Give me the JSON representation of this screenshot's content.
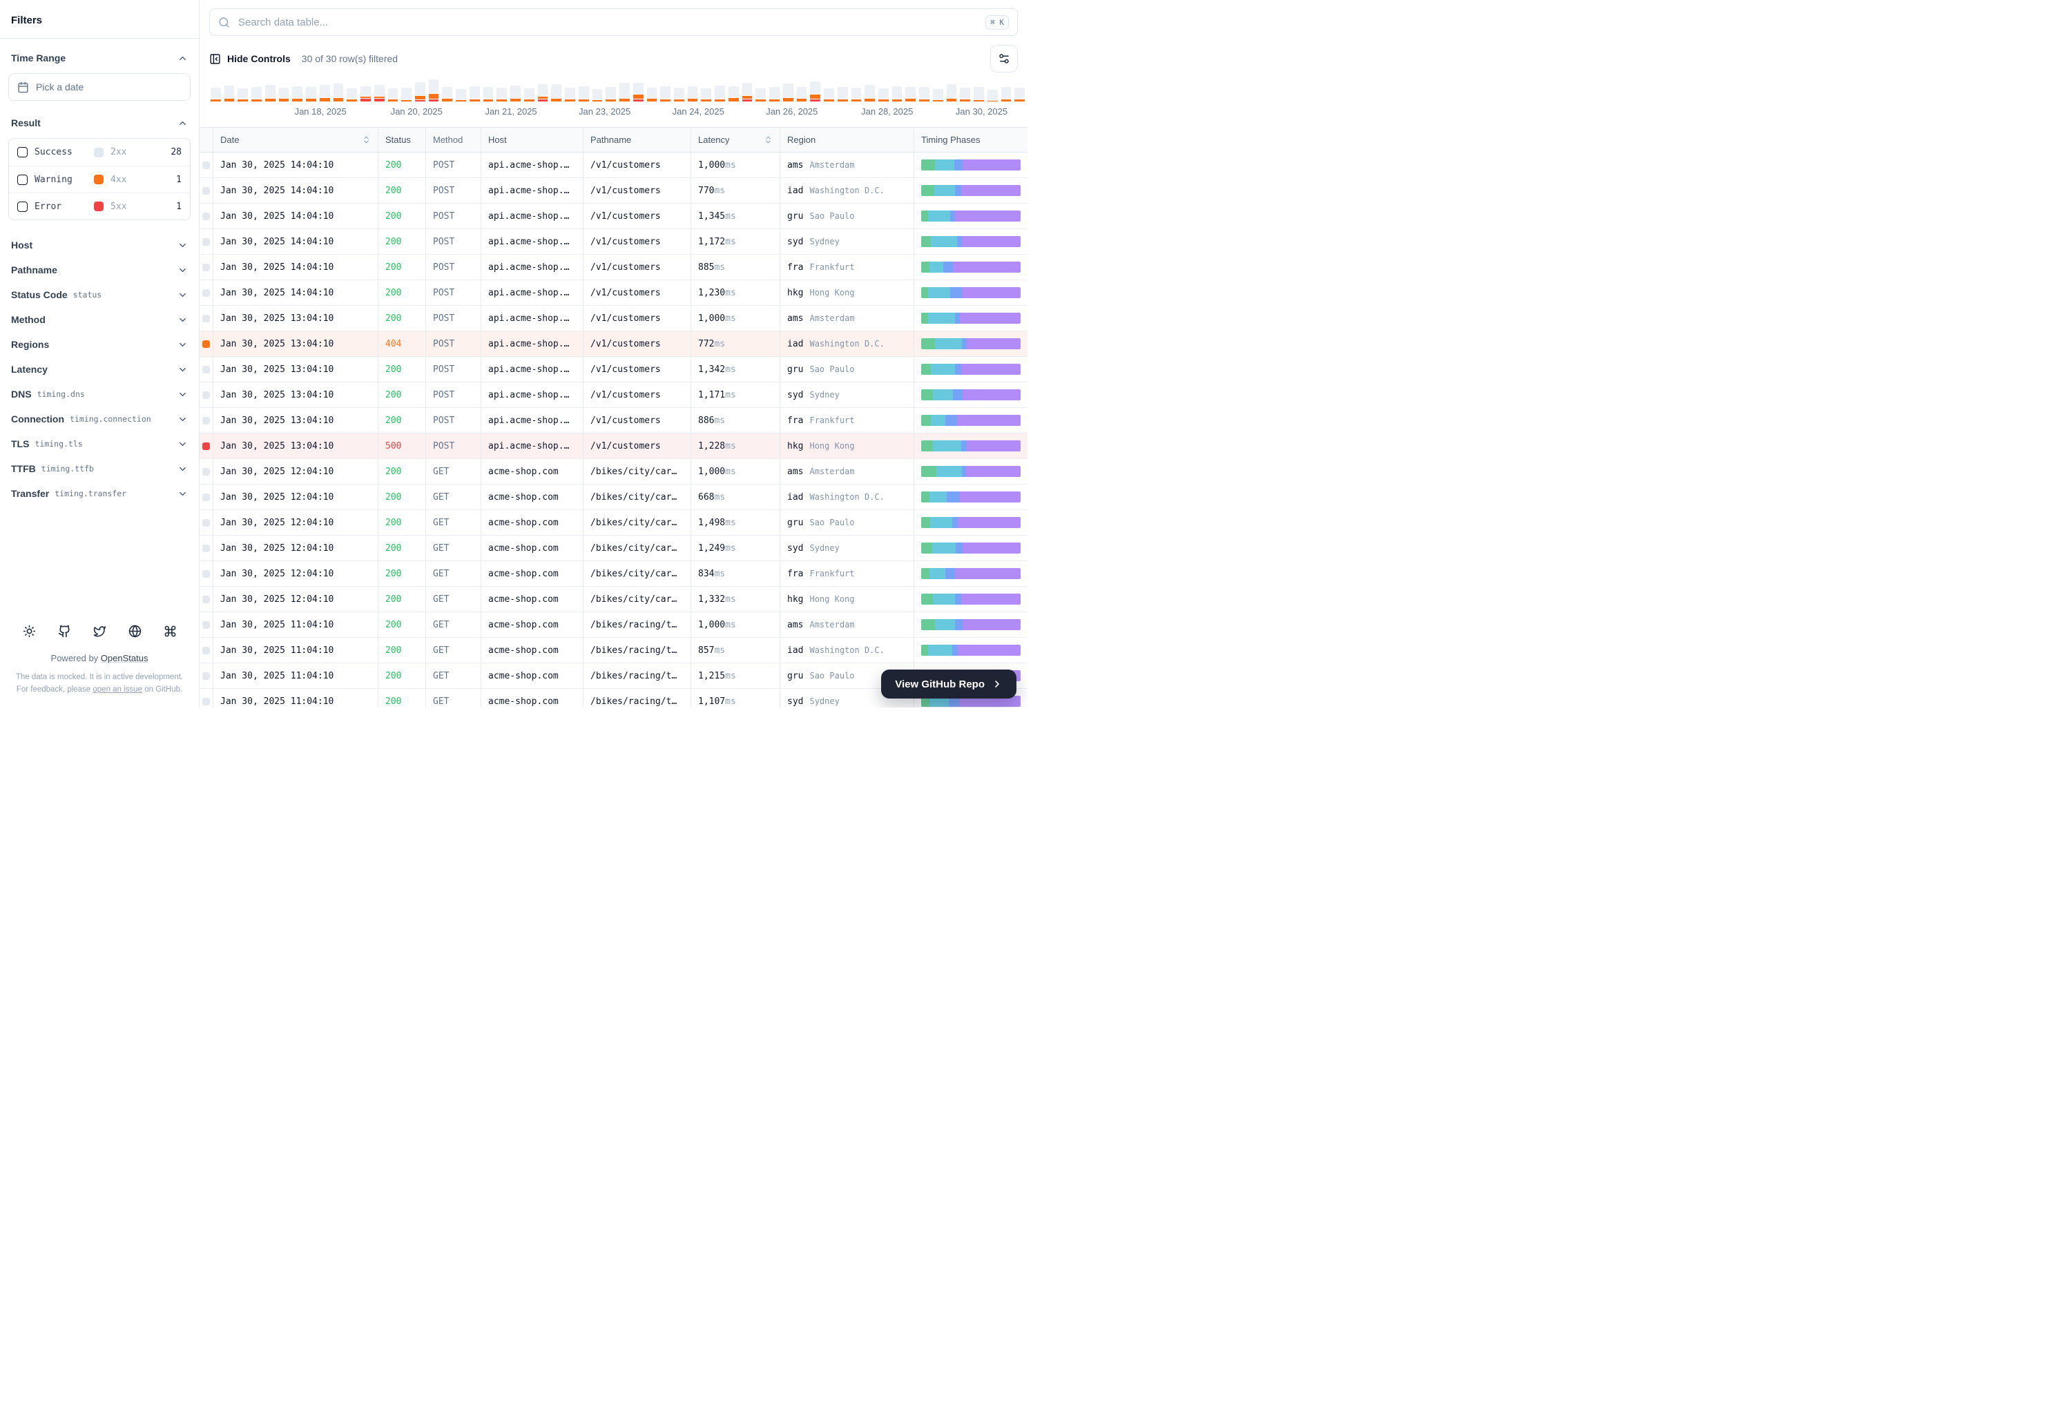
{
  "sidebar": {
    "title": "Filters",
    "time_range": {
      "label": "Time Range",
      "picker_placeholder": "Pick a date"
    },
    "result": {
      "label": "Result",
      "options": [
        {
          "label": "Success",
          "code": "2xx",
          "count": "28",
          "color": "#e2e8f0"
        },
        {
          "label": "Warning",
          "code": "4xx",
          "count": "1",
          "color": "#f97316"
        },
        {
          "label": "Error",
          "code": "5xx",
          "count": "1",
          "color": "#ef4444"
        }
      ]
    },
    "sections": [
      {
        "label": "Host",
        "sub": ""
      },
      {
        "label": "Pathname",
        "sub": ""
      },
      {
        "label": "Status Code",
        "sub": "status"
      },
      {
        "label": "Method",
        "sub": ""
      },
      {
        "label": "Regions",
        "sub": ""
      },
      {
        "label": "Latency",
        "sub": ""
      },
      {
        "label": "DNS",
        "sub": "timing.dns"
      },
      {
        "label": "Connection",
        "sub": "timing.connection"
      },
      {
        "label": "TLS",
        "sub": "timing.tls"
      },
      {
        "label": "TTFB",
        "sub": "timing.ttfb"
      },
      {
        "label": "Transfer",
        "sub": "timing.transfer"
      }
    ],
    "footer": {
      "icons": [
        "sun",
        "github",
        "twitter",
        "globe",
        "command"
      ],
      "powered_prefix": "Powered by ",
      "powered_link": "OpenStatus",
      "disclaimer_pre": "The data is mocked. It is in active development. For feedback, please ",
      "disclaimer_link": "open an issue",
      "disclaimer_post": " on GitHub."
    }
  },
  "toolbar": {
    "search_placeholder": "Search data table...",
    "kbd": "⌘ K",
    "hide_controls": "Hide Controls",
    "filtered": "30 of 30 row(s) filtered"
  },
  "chart_data": {
    "type": "bar",
    "stacked": true,
    "legend": "none",
    "x_tick_labels": [
      {
        "text": "Jan 18, 2025",
        "pos": 13.5
      },
      {
        "text": "Jan 20, 2025",
        "pos": 25.3
      },
      {
        "text": "Jan 21, 2025",
        "pos": 36.9
      },
      {
        "text": "Jan 23, 2025",
        "pos": 48.4
      },
      {
        "text": "Jan 24, 2025",
        "pos": 59.9
      },
      {
        "text": "Jan 26, 2025",
        "pos": 71.4
      },
      {
        "text": "Jan 28, 2025",
        "pos": 83.1
      },
      {
        "text": "Jan 30, 2025",
        "pos": 94.7
      }
    ],
    "series": [
      {
        "name": "success",
        "color": "#edf0f4",
        "values": [
          16,
          18,
          15,
          17,
          19,
          15,
          17,
          16,
          18,
          20,
          15,
          14,
          16,
          15,
          17,
          19,
          20,
          16,
          15,
          18,
          17,
          16,
          18,
          15,
          17,
          20,
          16,
          18,
          15,
          17,
          22,
          16,
          15,
          18,
          16,
          17,
          15,
          19,
          16,
          18,
          15,
          17,
          20,
          16,
          18,
          15,
          17,
          16,
          19,
          15,
          18,
          16,
          17,
          15,
          20,
          16,
          18,
          15,
          17,
          16
        ]
      },
      {
        "name": "warning",
        "color": "#f97316",
        "values": [
          3,
          4,
          3,
          3,
          4,
          4,
          4,
          4,
          5,
          5,
          3,
          2,
          2,
          3,
          2,
          5,
          7,
          4,
          2,
          3,
          3,
          3,
          4,
          3,
          3,
          4,
          3,
          3,
          2,
          3,
          4,
          6,
          4,
          3,
          3,
          4,
          3,
          3,
          5,
          4,
          3,
          3,
          5,
          4,
          6,
          3,
          3,
          3,
          4,
          3,
          3,
          4,
          3,
          2,
          4,
          3,
          2,
          1,
          3,
          3
        ]
      },
      {
        "name": "error",
        "color": "#ef4444",
        "values": [
          0,
          0,
          0,
          0,
          0,
          0,
          0,
          0,
          0,
          0,
          0,
          4,
          4,
          0,
          0,
          2,
          3,
          0,
          0,
          0,
          0,
          0,
          0,
          0,
          3,
          0,
          0,
          0,
          0,
          0,
          0,
          3,
          0,
          0,
          0,
          0,
          0,
          0,
          0,
          3,
          0,
          0,
          0,
          0,
          3,
          0,
          0,
          0,
          0,
          0,
          0,
          0,
          0,
          0,
          0,
          0,
          0,
          0,
          0,
          0
        ]
      }
    ]
  },
  "table": {
    "columns": [
      {
        "key": "indicator",
        "label": "",
        "sortable": false
      },
      {
        "key": "date",
        "label": "Date",
        "sortable": true
      },
      {
        "key": "status",
        "label": "Status",
        "sortable": false
      },
      {
        "key": "method",
        "label": "Method",
        "sortable": false
      },
      {
        "key": "host",
        "label": "Host",
        "sortable": false
      },
      {
        "key": "pathname",
        "label": "Pathname",
        "sortable": false
      },
      {
        "key": "latency",
        "label": "Latency",
        "sortable": true
      },
      {
        "key": "region",
        "label": "Region",
        "sortable": false
      },
      {
        "key": "timing",
        "label": "Timing Phases",
        "sortable": false
      }
    ],
    "latency_unit": "ms",
    "timing_colors": {
      "dns": "#68cb97",
      "connection": "#67c8de",
      "tls": "#76a3f7",
      "ttfb": "#b18cf8"
    },
    "rows": [
      {
        "date": "Jan 30, 2025 14:04:10",
        "status": "200",
        "level": "success",
        "method": "POST",
        "host": "api.acme-shop.…",
        "pathname": "/v1/customers",
        "latency": "1,000",
        "region_code": "ams",
        "region_city": "Amsterdam",
        "timing": [
          14,
          19,
          9,
          58
        ]
      },
      {
        "date": "Jan 30, 2025 14:04:10",
        "status": "200",
        "level": "success",
        "method": "POST",
        "host": "api.acme-shop.…",
        "pathname": "/v1/customers",
        "latency": "770",
        "region_code": "iad",
        "region_city": "Washington D.C.",
        "timing": [
          13,
          21,
          6,
          60
        ]
      },
      {
        "date": "Jan 30, 2025 14:04:10",
        "status": "200",
        "level": "success",
        "method": "POST",
        "host": "api.acme-shop.…",
        "pathname": "/v1/customers",
        "latency": "1,345",
        "region_code": "gru",
        "region_city": "Sao Paulo",
        "timing": [
          7,
          22,
          5,
          66
        ]
      },
      {
        "date": "Jan 30, 2025 14:04:10",
        "status": "200",
        "level": "success",
        "method": "POST",
        "host": "api.acme-shop.…",
        "pathname": "/v1/customers",
        "latency": "1,172",
        "region_code": "syd",
        "region_city": "Sydney",
        "timing": [
          10,
          26,
          5,
          59
        ]
      },
      {
        "date": "Jan 30, 2025 14:04:10",
        "status": "200",
        "level": "success",
        "method": "POST",
        "host": "api.acme-shop.…",
        "pathname": "/v1/customers",
        "latency": "885",
        "region_code": "fra",
        "region_city": "Frankfurt",
        "timing": [
          8,
          14,
          10,
          68
        ]
      },
      {
        "date": "Jan 30, 2025 14:04:10",
        "status": "200",
        "level": "success",
        "method": "POST",
        "host": "api.acme-shop.…",
        "pathname": "/v1/customers",
        "latency": "1,230",
        "region_code": "hkg",
        "region_city": "Hong Kong",
        "timing": [
          7,
          22,
          12,
          59
        ]
      },
      {
        "date": "Jan 30, 2025 13:04:10",
        "status": "200",
        "level": "success",
        "method": "POST",
        "host": "api.acme-shop.…",
        "pathname": "/v1/customers",
        "latency": "1,000",
        "region_code": "ams",
        "region_city": "Amsterdam",
        "timing": [
          7,
          27,
          5,
          61
        ]
      },
      {
        "date": "Jan 30, 2025 13:04:10",
        "status": "404",
        "level": "warning",
        "method": "POST",
        "host": "api.acme-shop.…",
        "pathname": "/v1/customers",
        "latency": "772",
        "region_code": "iad",
        "region_city": "Washington D.C.",
        "timing": [
          14,
          27,
          5,
          54
        ]
      },
      {
        "date": "Jan 30, 2025 13:04:10",
        "status": "200",
        "level": "success",
        "method": "POST",
        "host": "api.acme-shop.…",
        "pathname": "/v1/customers",
        "latency": "1,342",
        "region_code": "gru",
        "region_city": "Sao Paulo",
        "timing": [
          10,
          24,
          6,
          60
        ]
      },
      {
        "date": "Jan 30, 2025 13:04:10",
        "status": "200",
        "level": "success",
        "method": "POST",
        "host": "api.acme-shop.…",
        "pathname": "/v1/customers",
        "latency": "1,171",
        "region_code": "syd",
        "region_city": "Sydney",
        "timing": [
          12,
          20,
          10,
          58
        ]
      },
      {
        "date": "Jan 30, 2025 13:04:10",
        "status": "200",
        "level": "success",
        "method": "POST",
        "host": "api.acme-shop.…",
        "pathname": "/v1/customers",
        "latency": "886",
        "region_code": "fra",
        "region_city": "Frankfurt",
        "timing": [
          10,
          14,
          12,
          64
        ]
      },
      {
        "date": "Jan 30, 2025 13:04:10",
        "status": "500",
        "level": "error",
        "method": "POST",
        "host": "api.acme-shop.…",
        "pathname": "/v1/customers",
        "latency": "1,228",
        "region_code": "hkg",
        "region_city": "Hong Kong",
        "timing": [
          12,
          28,
          6,
          54
        ]
      },
      {
        "date": "Jan 30, 2025 12:04:10",
        "status": "200",
        "level": "success",
        "method": "GET",
        "host": "acme-shop.com",
        "pathname": "/bikes/city/car…",
        "latency": "1,000",
        "region_code": "ams",
        "region_city": "Amsterdam",
        "timing": [
          15,
          26,
          4,
          55
        ]
      },
      {
        "date": "Jan 30, 2025 12:04:10",
        "status": "200",
        "level": "success",
        "method": "GET",
        "host": "acme-shop.com",
        "pathname": "/bikes/city/car…",
        "latency": "668",
        "region_code": "iad",
        "region_city": "Washington D.C.",
        "timing": [
          8,
          18,
          12,
          62
        ]
      },
      {
        "date": "Jan 30, 2025 12:04:10",
        "status": "200",
        "level": "success",
        "method": "GET",
        "host": "acme-shop.com",
        "pathname": "/bikes/city/car…",
        "latency": "1,498",
        "region_code": "gru",
        "region_city": "Sao Paulo",
        "timing": [
          9,
          22,
          6,
          63
        ]
      },
      {
        "date": "Jan 30, 2025 12:04:10",
        "status": "200",
        "level": "success",
        "method": "GET",
        "host": "acme-shop.com",
        "pathname": "/bikes/city/car…",
        "latency": "1,249",
        "region_code": "syd",
        "region_city": "Sydney",
        "timing": [
          11,
          24,
          7,
          58
        ]
      },
      {
        "date": "Jan 30, 2025 12:04:10",
        "status": "200",
        "level": "success",
        "method": "GET",
        "host": "acme-shop.com",
        "pathname": "/bikes/city/car…",
        "latency": "834",
        "region_code": "fra",
        "region_city": "Frankfurt",
        "timing": [
          8,
          16,
          10,
          66
        ]
      },
      {
        "date": "Jan 30, 2025 12:04:10",
        "status": "200",
        "level": "success",
        "method": "GET",
        "host": "acme-shop.com",
        "pathname": "/bikes/city/car…",
        "latency": "1,332",
        "region_code": "hkg",
        "region_city": "Hong Kong",
        "timing": [
          12,
          22,
          6,
          60
        ]
      },
      {
        "date": "Jan 30, 2025 11:04:10",
        "status": "200",
        "level": "success",
        "method": "GET",
        "host": "acme-shop.com",
        "pathname": "/bikes/racing/t…",
        "latency": "1,000",
        "region_code": "ams",
        "region_city": "Amsterdam",
        "timing": [
          14,
          20,
          8,
          58
        ]
      },
      {
        "date": "Jan 30, 2025 11:04:10",
        "status": "200",
        "level": "success",
        "method": "GET",
        "host": "acme-shop.com",
        "pathname": "/bikes/racing/t…",
        "latency": "857",
        "region_code": "iad",
        "region_city": "Washington D.C.",
        "timing": [
          7,
          24,
          6,
          63
        ]
      },
      {
        "date": "Jan 30, 2025 11:04:10",
        "status": "200",
        "level": "success",
        "method": "GET",
        "host": "acme-shop.com",
        "pathname": "/bikes/racing/t…",
        "latency": "1,215",
        "region_code": "gru",
        "region_city": "Sao Paulo",
        "timing": [
          13,
          21,
          8,
          58
        ]
      },
      {
        "date": "Jan 30, 2025 11:04:10",
        "status": "200",
        "level": "success",
        "method": "GET",
        "host": "acme-shop.com",
        "pathname": "/bikes/racing/t…",
        "latency": "1,107",
        "region_code": "syd",
        "region_city": "Sydney",
        "timing": [
          8,
          20,
          10,
          62
        ]
      }
    ]
  },
  "github_button": {
    "label": "View GitHub Repo"
  }
}
